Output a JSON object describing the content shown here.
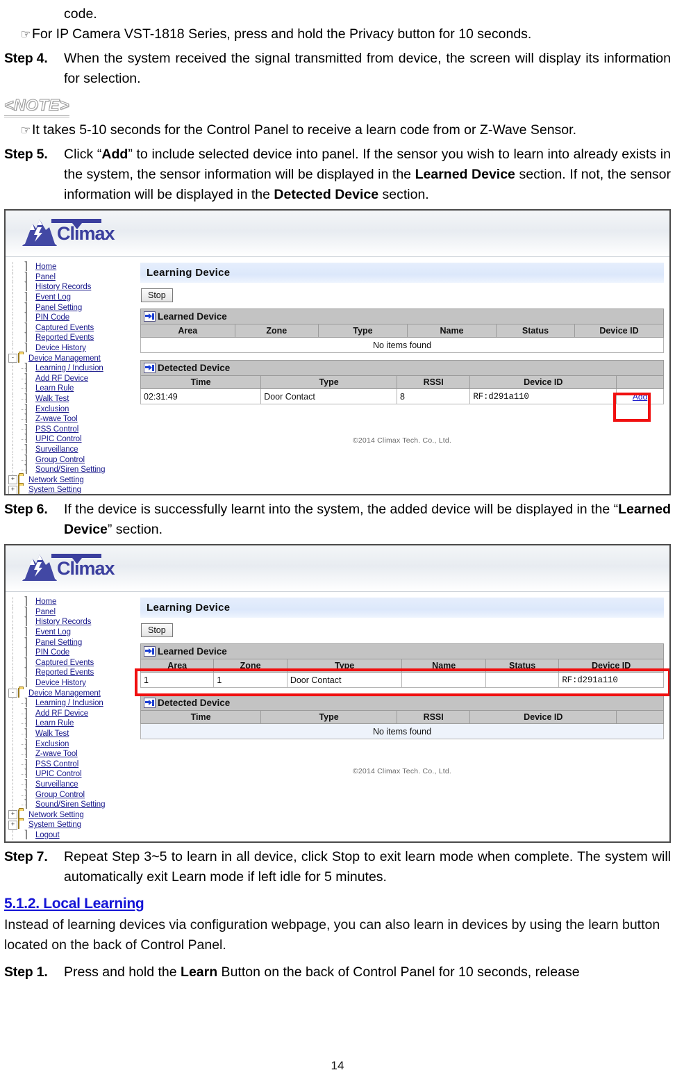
{
  "doc": {
    "page_number": "14",
    "intro_fragment": "code.",
    "bullet_glyph": "☞",
    "bullet_1": "For IP Camera VST-1818 Series, press and hold the Privacy button for 10 seconds.",
    "step4_label": "Step 4.",
    "step4_text": "When the system received the signal transmitted from device, the screen will display its information for selection.",
    "note_heading": "<NOTE>",
    "note_bullet": "It takes 5-10 seconds for the Control Panel to receive a learn code from      or Z-Wave Sensor.",
    "step5_label": "Step 5.",
    "step5_parts": {
      "a": "Click “",
      "b_bold": "Add",
      "c": "” to include selected device into panel. If the sensor you wish to learn into already exists in the system, the sensor information will be displayed in the ",
      "d_bold": "Learned Device",
      "e": " section. If not, the sensor information will be displayed in the ",
      "f_bold": "Detected Device",
      "g": " section."
    },
    "step6_label": "Step 6.",
    "step6_parts": {
      "a": "If the device is successfully learnt into the system, the added device will be displayed in the “",
      "b_bold": "Learned Device",
      "c": "” section."
    },
    "step7_label": "Step 7.",
    "step7_text": "Repeat Step 3~5 to learn in all device, click Stop to exit learn mode when complete. The system will automatically exit Learn mode if left idle for 5 minutes.",
    "section_heading": "5.1.2. Local Learning",
    "section_heading_color": "#1414d6",
    "section_body": "Instead of learning devices via configuration webpage, you can also learn in devices by using the learn button located on the back of Control Panel.",
    "step1_label": "Step 1.",
    "step1_parts": {
      "a": "Press and hold the ",
      "b_bold": "Learn",
      "c": " Button on the back of Control Panel for 10 seconds, release"
    }
  },
  "webui": {
    "brand": "Climax",
    "brand_color": "#3b3f9e",
    "page_title": "Learning Device",
    "stop_button": "Stop",
    "copyright": "©2014 Climax Tech. Co., Ltd.",
    "sidebar": [
      {
        "label": "Home",
        "icon": "page-icon",
        "depth": 0,
        "expander": ""
      },
      {
        "label": "Panel",
        "icon": "page-icon",
        "depth": 0,
        "expander": ""
      },
      {
        "label": "History Records",
        "icon": "page-icon",
        "depth": 0,
        "expander": ""
      },
      {
        "label": "Event Log",
        "icon": "page-icon",
        "depth": 0,
        "expander": ""
      },
      {
        "label": "Panel Setting",
        "icon": "page-icon",
        "depth": 0,
        "expander": ""
      },
      {
        "label": "PIN Code",
        "icon": "page-icon",
        "depth": 0,
        "expander": ""
      },
      {
        "label": "Captured Events",
        "icon": "page-icon",
        "depth": 0,
        "expander": ""
      },
      {
        "label": "Reported Events",
        "icon": "page-icon",
        "depth": 0,
        "expander": ""
      },
      {
        "label": "Device History",
        "icon": "page-icon",
        "depth": 0,
        "expander": ""
      },
      {
        "label": "Device Management",
        "icon": "folder-open-icon",
        "depth": 0,
        "expander": "-"
      },
      {
        "label": "Learning / Inclusion",
        "icon": "page-icon",
        "depth": 1,
        "expander": ""
      },
      {
        "label": "Add RF Device",
        "icon": "page-icon",
        "depth": 1,
        "expander": ""
      },
      {
        "label": "Learn Rule",
        "icon": "page-icon",
        "depth": 1,
        "expander": ""
      },
      {
        "label": "Walk Test",
        "icon": "page-icon",
        "depth": 1,
        "expander": ""
      },
      {
        "label": "Exclusion",
        "icon": "page-icon",
        "depth": 1,
        "expander": ""
      },
      {
        "label": "Z-wave Tool",
        "icon": "page-icon",
        "depth": 1,
        "expander": ""
      },
      {
        "label": "PSS Control",
        "icon": "page-icon",
        "depth": 1,
        "expander": ""
      },
      {
        "label": "UPIC Control",
        "icon": "page-icon",
        "depth": 1,
        "expander": ""
      },
      {
        "label": "Surveillance",
        "icon": "page-icon",
        "depth": 1,
        "expander": ""
      },
      {
        "label": "Group Control",
        "icon": "page-icon",
        "depth": 1,
        "expander": ""
      },
      {
        "label": "Sound/Siren Setting",
        "icon": "page-icon",
        "depth": 1,
        "expander": ""
      },
      {
        "label": "Network Setting",
        "icon": "folder-icon",
        "depth": 0,
        "expander": "+"
      },
      {
        "label": "System Setting",
        "icon": "folder-icon",
        "depth": 0,
        "expander": "+"
      },
      {
        "label": "Logout",
        "icon": "page-icon",
        "depth": 0,
        "expander": ""
      }
    ],
    "learned_section_title": "Learned Device",
    "detected_section_title": "Detected Device",
    "learned_columns": [
      "Area",
      "Zone",
      "Type",
      "Name",
      "Status",
      "Device ID"
    ],
    "detected_columns": [
      "Time",
      "Type",
      "RSSI",
      "Device ID",
      ""
    ],
    "empty_message": "No items found",
    "add_link": "Add",
    "highlight_color": "#f01010"
  },
  "shot_one": {
    "learned_rows": [],
    "learned_empty": "No items found",
    "detected_rows": [
      {
        "time": "02:31:49",
        "type": "Door Contact",
        "rssi": "8",
        "device_id": "RF:d291a110",
        "action": "Add"
      }
    ]
  },
  "shot_two": {
    "learned_rows": [
      {
        "area": "1",
        "zone": "1",
        "type": "Door Contact",
        "name": "",
        "status": "",
        "device_id": "RF:d291a110"
      }
    ],
    "detected_rows": [],
    "detected_empty": "No items found"
  }
}
